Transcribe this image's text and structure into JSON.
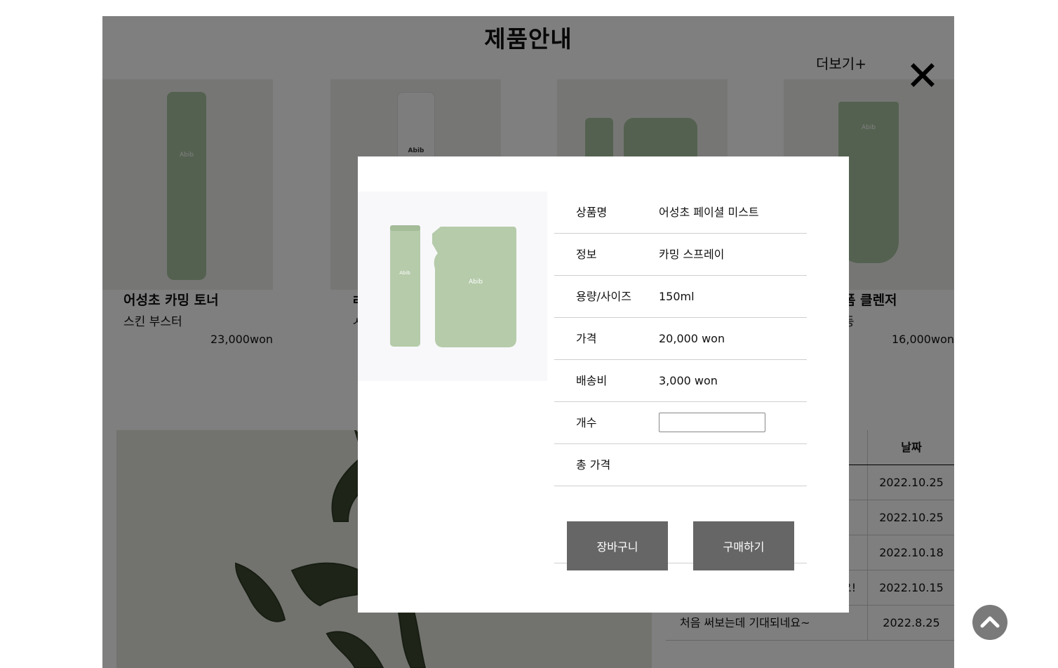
{
  "page": {
    "title": "제품안내",
    "more_link": "더보기+",
    "products": [
      {
        "name": "어성초 카밍 토너",
        "desc": "스킨 부스터",
        "price": "23,000won",
        "brand": "Abib"
      },
      {
        "name": "ㄹ",
        "desc": "ㅅ",
        "price": "",
        "brand": "Abib"
      },
      {
        "name": "",
        "desc": "",
        "price": "",
        "brand": ""
      },
      {
        "name": "폼 클렌저",
        "desc": "등",
        "price": "16,000won",
        "brand": "Abib"
      }
    ],
    "board": {
      "date_header": "날짜",
      "rows": [
        {
          "title": "",
          "date": "2022.10.25"
        },
        {
          "title": "",
          "date": "2022.10.25"
        },
        {
          "title": "",
          "date": "2022.10.18"
        },
        {
          "title": "요!",
          "date": "2022.10.15"
        },
        {
          "title": "처음 써보는데 기대되네요~",
          "date": "2022.8.25"
        }
      ]
    }
  },
  "modal": {
    "image_brand": "Abib",
    "rows": [
      {
        "label": "상품명",
        "value": "어성초 페이셜 미스트"
      },
      {
        "label": "정보",
        "value": "카밍 스프레이"
      },
      {
        "label": "용량/사이즈",
        "value": "150ml"
      },
      {
        "label": "가격",
        "value": "20,000 won"
      },
      {
        "label": "배송비",
        "value": "3,000 won"
      },
      {
        "label": "개수",
        "value": ""
      },
      {
        "label": "총 가격",
        "value": ""
      }
    ],
    "quantity_value": "",
    "cart_button": "장바구니",
    "buy_button": "구매하기"
  },
  "icons": {
    "close": "close-icon",
    "scroll_top": "chevron-up-icon"
  },
  "colors": {
    "overlay": "rgba(0,0,0,0.5)",
    "button": "#666666",
    "product_green": "#a9c2a0",
    "scroll_top_bg": "#7a7a7a"
  }
}
